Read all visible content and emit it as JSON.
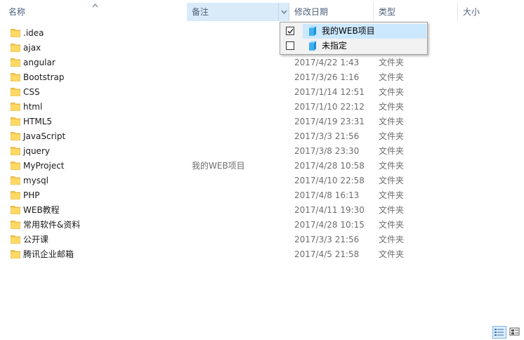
{
  "columns": {
    "name": "名称",
    "note": "备注",
    "date": "修改日期",
    "type": "类型",
    "size": "大小"
  },
  "dropdown": {
    "options": [
      {
        "label": "我的WEB项目",
        "checked": true
      },
      {
        "label": "未指定",
        "checked": false
      }
    ]
  },
  "files": [
    {
      "name": ".idea",
      "note": "",
      "date": "",
      "type": ""
    },
    {
      "name": "ajax",
      "note": "",
      "date": "",
      "type": ""
    },
    {
      "name": "angular",
      "note": "",
      "date": "2017/4/22 1:43",
      "type": "文件夹"
    },
    {
      "name": "Bootstrap",
      "note": "",
      "date": "2017/3/26 1:16",
      "type": "文件夹"
    },
    {
      "name": "CSS",
      "note": "",
      "date": "2017/1/14 12:51",
      "type": "文件夹"
    },
    {
      "name": "html",
      "note": "",
      "date": "2017/1/10 22:12",
      "type": "文件夹"
    },
    {
      "name": "HTML5",
      "note": "",
      "date": "2017/4/19 23:31",
      "type": "文件夹"
    },
    {
      "name": "JavaScript",
      "note": "",
      "date": "2017/3/3 21:56",
      "type": "文件夹"
    },
    {
      "name": "jquery",
      "note": "",
      "date": "2017/3/8 23:30",
      "type": "文件夹"
    },
    {
      "name": "MyProject",
      "note": "我的WEB项目",
      "date": "2017/4/28 10:58",
      "type": "文件夹"
    },
    {
      "name": "mysql",
      "note": "",
      "date": "2017/4/10 22:58",
      "type": "文件夹"
    },
    {
      "name": "PHP",
      "note": "",
      "date": "2017/4/8 16:13",
      "type": "文件夹"
    },
    {
      "name": "WEB教程",
      "note": "",
      "date": "2017/4/11 19:30",
      "type": "文件夹"
    },
    {
      "name": "常用软件&资料",
      "note": "",
      "date": "2017/4/28 10:15",
      "type": "文件夹"
    },
    {
      "name": "公开课",
      "note": "",
      "date": "2017/3/3 21:56",
      "type": "文件夹"
    },
    {
      "name": "腾讯企业邮箱",
      "note": "",
      "date": "2017/4/5 21:58",
      "type": "文件夹"
    }
  ],
  "icons": {
    "folder": "folder-icon",
    "sort": "sort-ascending-icon",
    "dropdown": "chevron-down-icon",
    "filter_item": "cube-icon",
    "view_details": "details-view-icon",
    "view_tiles": "large-icons-view-icon"
  },
  "colors": {
    "header_text": "#4c607a",
    "header_active_bg": "#d9ebf9",
    "dropdown_highlight": "#cce8ff",
    "folder": "#f5c94c",
    "detail_text": "#6d6d6d"
  }
}
